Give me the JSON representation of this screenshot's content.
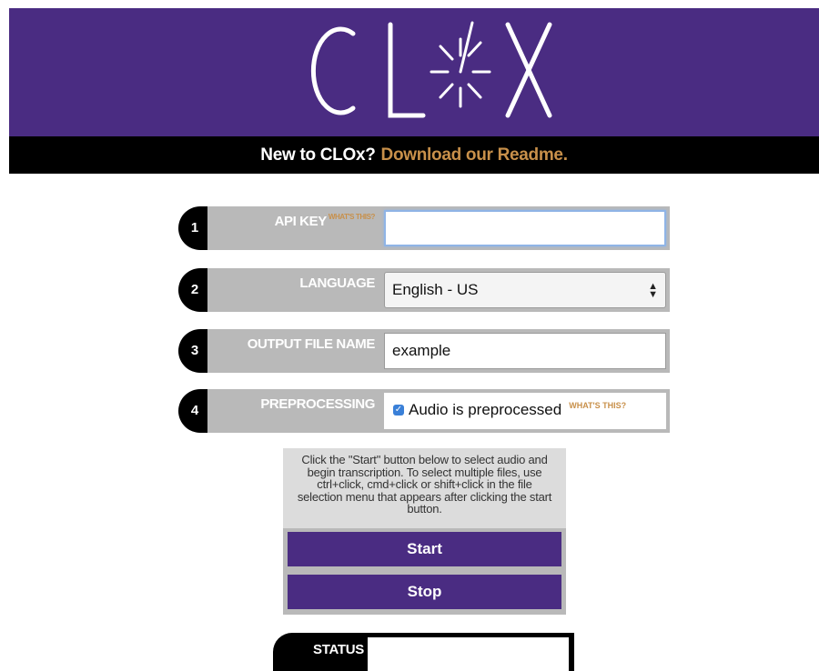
{
  "header": {
    "logo_text": "CLOX",
    "tagline_question": "New to CLOx?",
    "readme_link": "Download our Readme."
  },
  "form": {
    "rows": [
      {
        "number": "1",
        "label": "API KEY",
        "help": "WHAT'S THIS?",
        "value": ""
      },
      {
        "number": "2",
        "label": "LANGUAGE",
        "value": "English - US"
      },
      {
        "number": "3",
        "label": "OUTPUT FILE NAME",
        "value": "example"
      },
      {
        "number": "4",
        "label": "PREPROCESSING",
        "checkbox_label": "Audio is preprocessed",
        "checked": true,
        "help": "WHAT'S THIS?"
      }
    ]
  },
  "controls": {
    "instructions": "Click the \"Start\" button below to select audio and begin transcription. To select multiple files, use ctrl+click, cmd+click or shift+click in the file selection menu that appears after clicking the start button.",
    "start_label": "Start",
    "stop_label": "Stop"
  },
  "status": {
    "label": "STATUS",
    "value": ""
  },
  "colors": {
    "brand_purple": "#4a2c82",
    "accent_gold": "#c8904a",
    "panel_gray": "#b9b9b9"
  },
  "icons": [
    "clock-logo-icon",
    "select-arrows-icon",
    "checkbox-checked-icon"
  ]
}
